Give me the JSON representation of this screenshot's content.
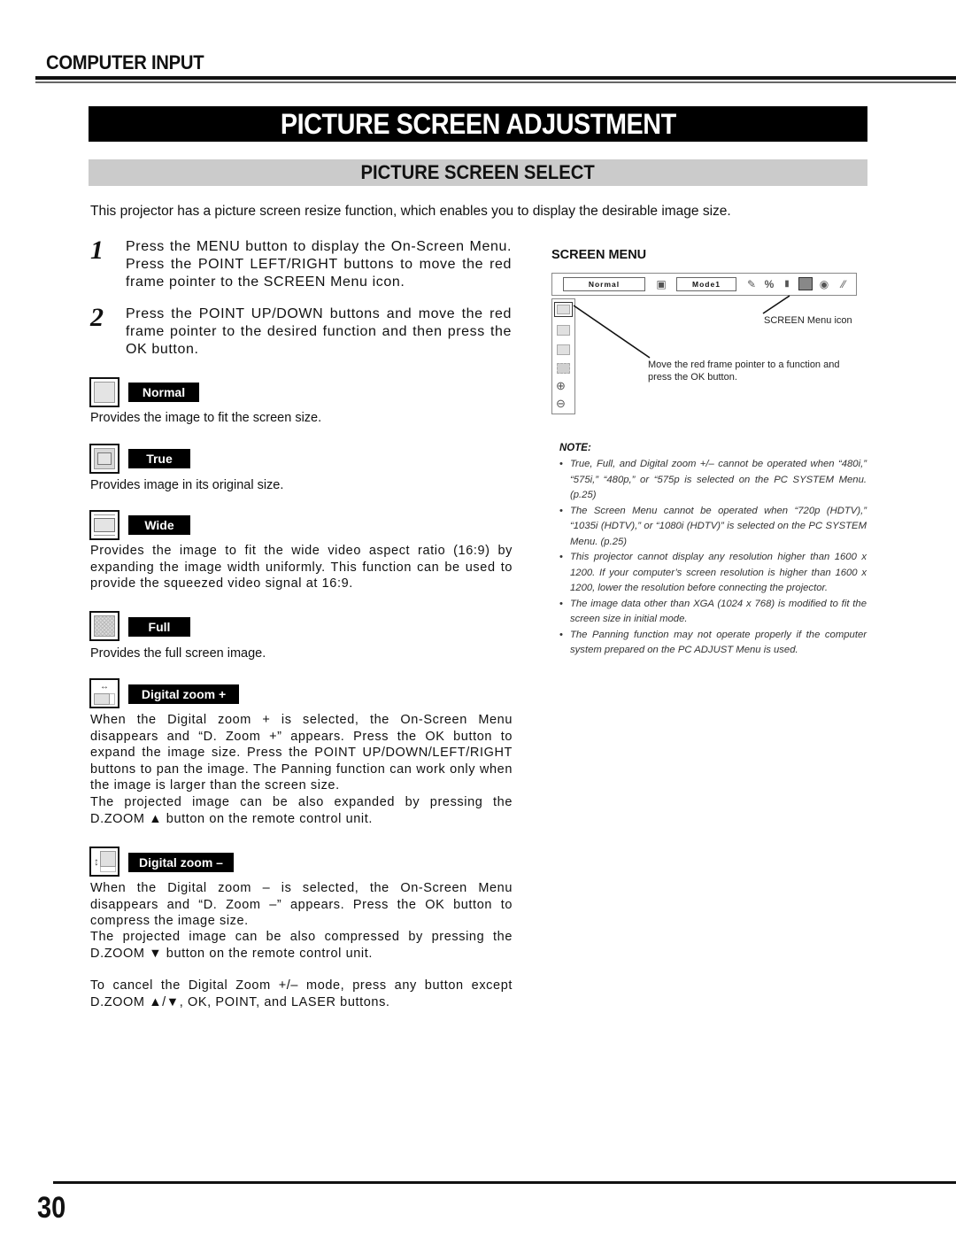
{
  "header": {
    "section": "COMPUTER INPUT",
    "title": "PICTURE SCREEN ADJUSTMENT",
    "subtitle": "PICTURE SCREEN SELECT"
  },
  "intro": "This projector has a picture screen resize function, which enables you to display the desirable image size.",
  "steps": [
    {
      "number": "1",
      "text": "Press the MENU button to display the On-Screen Menu. Press the POINT LEFT/RIGHT buttons to move the red frame pointer to the SCREEN Menu icon."
    },
    {
      "number": "2",
      "text": "Press the POINT UP/DOWN buttons and move the red frame pointer to the desired function and then press the OK button."
    }
  ],
  "options": [
    {
      "icon": "normal-screen-icon",
      "label": "Normal",
      "description": "Provides the image to fit the screen size."
    },
    {
      "icon": "true-screen-icon",
      "label": "True",
      "description": "Provides image in its original size."
    },
    {
      "icon": "wide-screen-icon",
      "label": "Wide",
      "description": "Provides the image to fit the wide video aspect ratio (16:9) by expanding the image width uniformly. This function can be used to provide the squeezed video signal at 16:9."
    },
    {
      "icon": "full-screen-icon",
      "label": "Full",
      "description": "Provides the full screen image."
    },
    {
      "icon": "digital-zoom-plus-icon",
      "label": "Digital zoom +",
      "description": "When the Digital zoom + is selected, the On-Screen Menu disappears and “D. Zoom +” appears. Press the OK button to expand the image size. Press the POINT UP/DOWN/LEFT/RIGHT buttons to pan the image. The Panning function can work only when the image is larger than the screen size.",
      "extra": "The projected image can be also expanded by pressing the D.ZOOM ▲ button on the remote control unit."
    },
    {
      "icon": "digital-zoom-minus-icon",
      "label": "Digital zoom –",
      "description": "When the Digital zoom – is selected, the On-Screen Menu disappears and “D. Zoom –” appears. Press the OK button to compress the image size.",
      "extra": "The projected image can be also compressed by pressing the D.ZOOM ▼ button on the remote control unit."
    }
  ],
  "cancel_note": "To cancel the Digital Zoom +/– mode, press any button except D.ZOOM ▲/▼, OK, POINT, and LASER buttons.",
  "screen_menu": {
    "title": "SCREEN MENU",
    "menu_value_1": "Normal",
    "menu_value_2": "Mode1",
    "top_icons": [
      "image-adjust-icon",
      "pc-adjust-icon",
      "image-select-icon",
      "screen-menu-icon",
      "lamp-icon",
      "setting-icon"
    ],
    "side_icons": [
      "normal-icon",
      "true-icon",
      "wide-icon",
      "full-icon",
      "zoom-in-icon",
      "zoom-out-icon"
    ],
    "callout_icon": "SCREEN Menu icon",
    "callout_pointer": "Move the red frame pointer to a function and press the OK button."
  },
  "note": {
    "title": "NOTE:",
    "items": [
      "True, Full, and Digital zoom +/– cannot be operated when “480i,” “575i,” “480p,” or “575p is selected on the PC SYSTEM Menu. (p.25)",
      "The Screen Menu cannot be operated when “720p (HDTV),” “1035i (HDTV),” or “1080i (HDTV)” is selected on the PC SYSTEM Menu. (p.25)",
      "This projector cannot display any resolution higher than 1600 x 1200. If your computer’s screen resolution is higher than 1600 x 1200, lower the resolution before connecting the projector.",
      "The image data other than XGA (1024 x 768) is modified to fit the screen size in initial mode.",
      "The Panning function may not operate properly if the computer system prepared on the PC ADJUST Menu is used."
    ]
  },
  "page_number": "30"
}
